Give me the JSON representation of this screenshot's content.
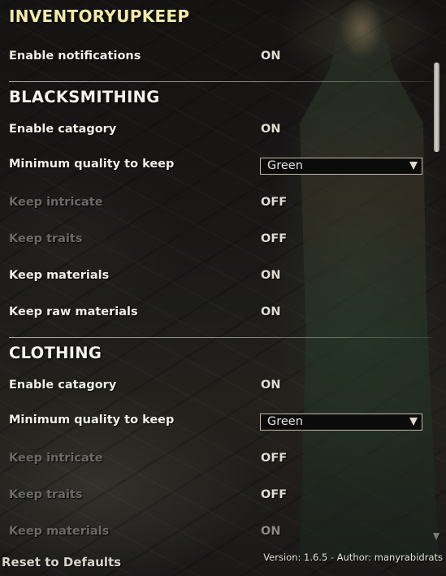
{
  "title": "INVENTORYUPKEEP",
  "global": {
    "enable_notifications": {
      "label": "Enable notifications",
      "value": "ON"
    }
  },
  "blacksmithing": {
    "header": "BLACKSMITHING",
    "enable_category": {
      "label": "Enable catagory",
      "value": "ON"
    },
    "min_quality": {
      "label": "Minimum quality to keep",
      "value": "Green"
    },
    "keep_intricate": {
      "label": "Keep intricate",
      "value": "OFF"
    },
    "keep_traits": {
      "label": "Keep traits",
      "value": "OFF"
    },
    "keep_materials": {
      "label": "Keep materials",
      "value": "ON"
    },
    "keep_raw_materials": {
      "label": "Keep raw materials",
      "value": "ON"
    }
  },
  "clothing": {
    "header": "CLOTHING",
    "enable_category": {
      "label": "Enable catagory",
      "value": "ON"
    },
    "min_quality": {
      "label": "Minimum quality to keep",
      "value": "Green"
    },
    "keep_intricate": {
      "label": "Keep intricate",
      "value": "OFF"
    },
    "keep_traits": {
      "label": "Keep traits",
      "value": "OFF"
    },
    "keep_materials": {
      "label": "Keep materials",
      "value": "ON"
    }
  },
  "footer": {
    "reset_label": "Reset to Defaults",
    "version_label": "Version: 1.6.5",
    "separator": "-",
    "author_label": "Author: manyrabidrats"
  },
  "colors": {
    "title": "#f2eba8",
    "text": "#f1efe8",
    "disabled_text": "#6b6a66"
  }
}
